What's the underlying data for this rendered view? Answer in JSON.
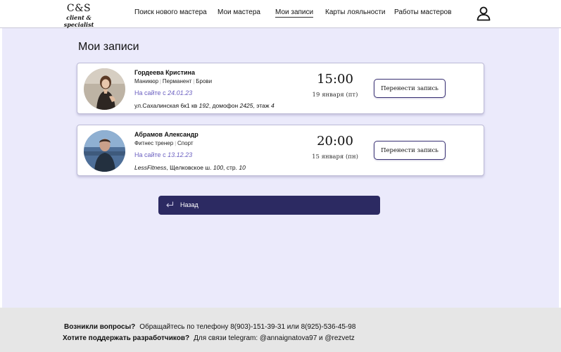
{
  "header": {
    "logo": {
      "main": "C&S",
      "sub": "client & specialist"
    },
    "nav": [
      {
        "label": "Поиск нового мастера"
      },
      {
        "label": "Мои мастера"
      },
      {
        "label": "Мои записи"
      },
      {
        "label": "Карты лояльности"
      },
      {
        "label": "Работы мастеров"
      }
    ],
    "active_nav": "Мои записи",
    "profile_icon": "user-icon"
  },
  "page": {
    "title": "Мои записи"
  },
  "appointments": [
    {
      "name": "Гордеева Кристина",
      "tags": [
        "Маникюр",
        "Перманент",
        "Брови"
      ],
      "since_label": "На сайте с",
      "since_date": "24.01.23",
      "address": {
        "street": "ул.Сахалинская 6к1 кв",
        "house": "192",
        "mid": ", домофон",
        "code": "2425",
        "tail": ", этаж",
        "floor": "4"
      },
      "time": "15:00",
      "date": "19 января (пт)",
      "button": "Перенести запись"
    },
    {
      "name": "Абрамов Александр",
      "tags": [
        "Фитнес тренер",
        "Спорт"
      ],
      "since_label": "На сайте с",
      "since_date": "13.12.23",
      "address": {
        "club": "LessFitness",
        "street": ", Щелковское ш.",
        "house": "100",
        "tail": ", стр.",
        "building": "10"
      },
      "time": "20:00",
      "date": "15 января (пн)",
      "button": "Перенести запись"
    }
  ],
  "back_button": {
    "label": "Назад",
    "icon": "return-arrow-icon"
  },
  "footer": {
    "q1": "Возникли вопросы?",
    "a1": "Обращайтесь по телефону 8(903)-151-39-31 или 8(925)-536-45-98",
    "q2": "Хотите поддержать разработчиков?",
    "a2": "Для связи telegram: @annaignatova97 и @rezvetz"
  },
  "colors": {
    "page_bg": "#ebeafb",
    "accent": "#2c2a62",
    "link": "#6a5fc0",
    "footer_bg": "#e6e6e6"
  }
}
